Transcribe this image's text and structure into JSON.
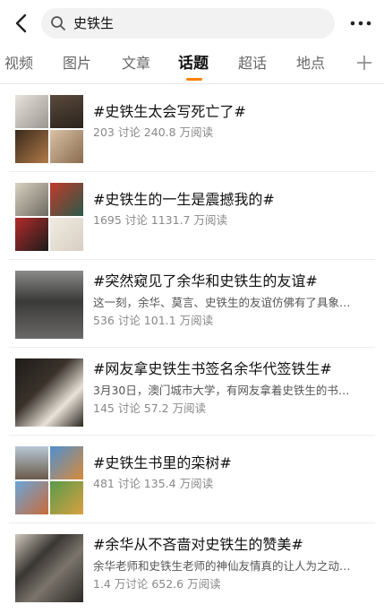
{
  "search": {
    "query": "史铁生"
  },
  "tabs": [
    {
      "label": "视频",
      "active": false
    },
    {
      "label": "图片",
      "active": false
    },
    {
      "label": "文章",
      "active": false
    },
    {
      "label": "话题",
      "active": true
    },
    {
      "label": "超话",
      "active": false
    },
    {
      "label": "地点",
      "active": false
    }
  ],
  "colors": {
    "accent": "#ff8200"
  },
  "topics": [
    {
      "title": "#史铁生太会写死亡了#",
      "desc": "",
      "stats": "203 讨论  240.8 万阅读"
    },
    {
      "title": "#史铁生的一生是震撼我的#",
      "desc": "",
      "stats": "1695 讨论  1131.7 万阅读"
    },
    {
      "title": "#突然窥见了余华和史铁生的友谊#",
      "desc": "这一刻，余华、莫言、史铁生的友谊仿佛有了具象…",
      "stats": "536 讨论  101.1 万阅读"
    },
    {
      "title": "#网友拿史铁生书签名余华代签铁生#",
      "desc": "3月30日，澳门城市大学，有网友拿着史铁生的书…",
      "stats": "145 讨论  57.2 万阅读"
    },
    {
      "title": "#史铁生书里的栾树#",
      "desc": "",
      "stats": "481 讨论  135.4 万阅读"
    },
    {
      "title": "#余华从不吝啬对史铁生的赞美#",
      "desc": "余华老师和史铁生老师的神仙友情真的让人为之动…",
      "stats": "1.4 万讨论  652.6 万阅读"
    }
  ]
}
